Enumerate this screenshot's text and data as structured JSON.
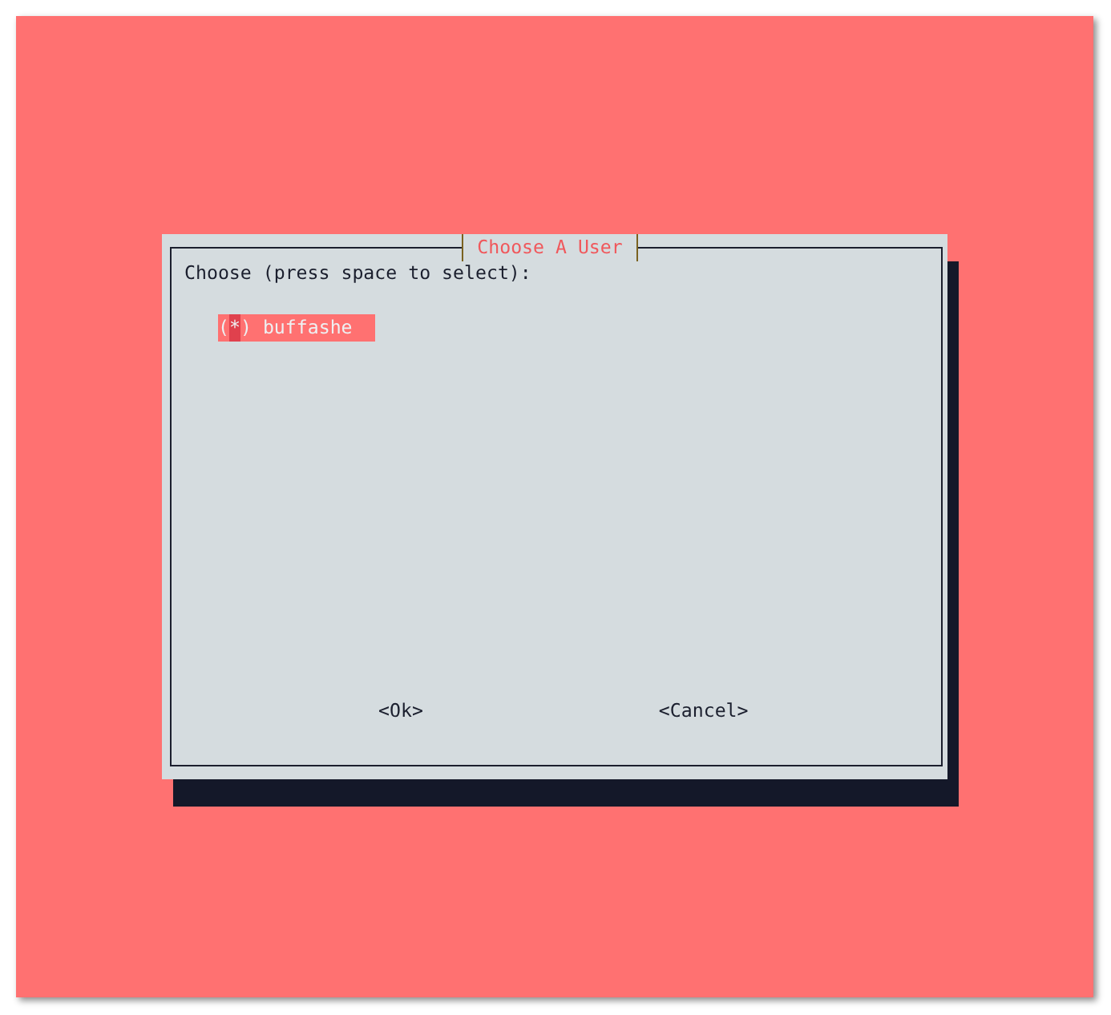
{
  "window": {
    "title": "Choose A User"
  },
  "prompt": "Choose (press space to select):",
  "options": [
    {
      "marker": "(*)",
      "label": "buffashe",
      "selected": true,
      "cursor": true
    }
  ],
  "buttons": [
    "<Ok>",
    "<Cancel>"
  ]
}
